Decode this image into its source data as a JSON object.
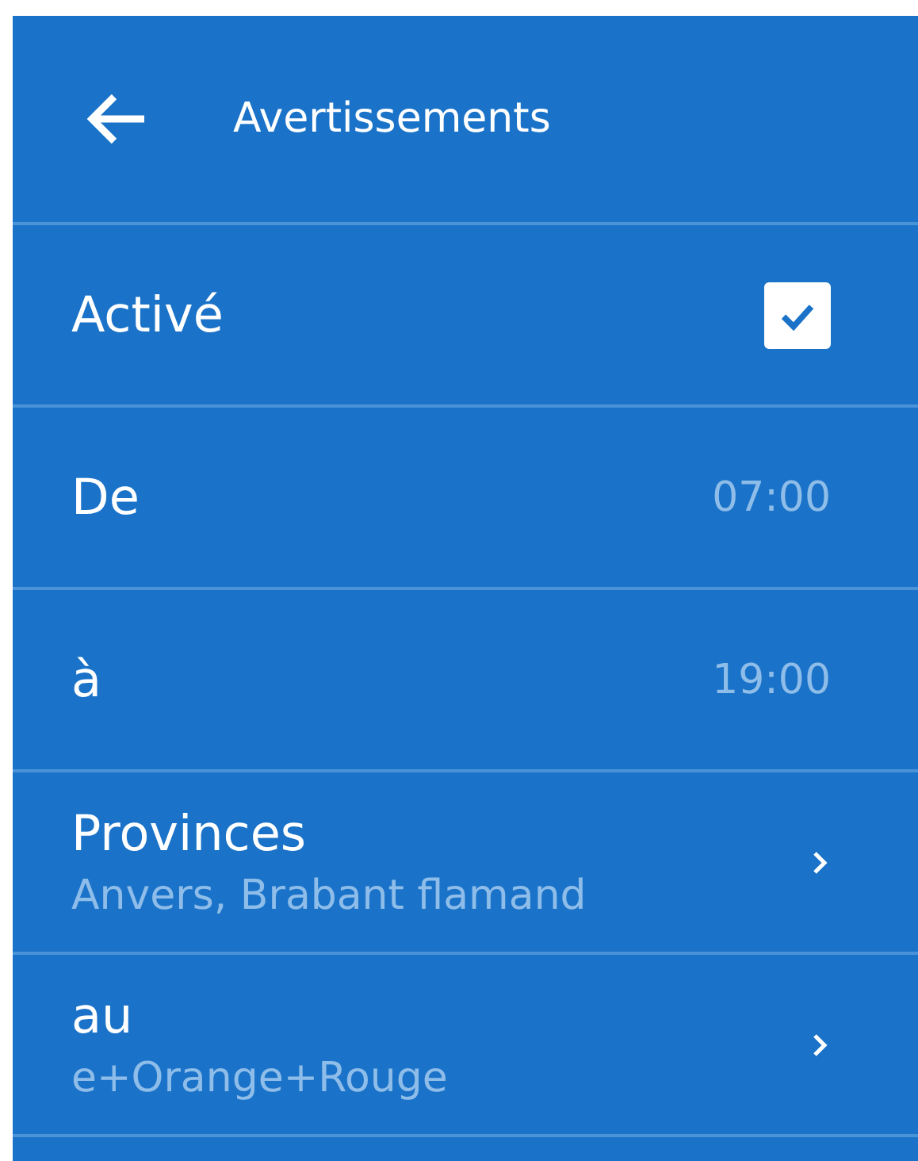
{
  "header": {
    "title": "Avertissements"
  },
  "rows": [
    {
      "kind": "checkbox",
      "label": "Activé",
      "checked": true
    },
    {
      "kind": "time",
      "label": "De",
      "value": "07:00"
    },
    {
      "kind": "time",
      "label": "à",
      "value": "19:00"
    },
    {
      "kind": "nav",
      "label": "Provinces",
      "subtitle": "Anvers, Brabant flamand"
    },
    {
      "kind": "nav",
      "label": "au",
      "subtitle": "e+Orange+Rouge"
    }
  ]
}
